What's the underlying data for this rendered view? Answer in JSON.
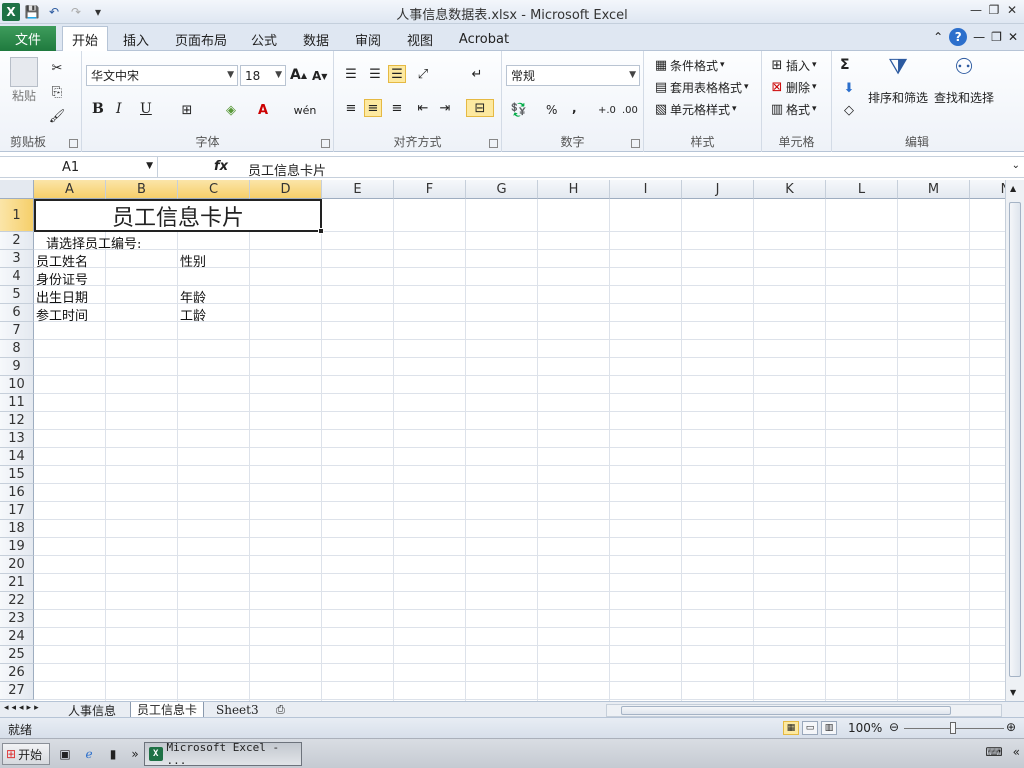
{
  "window": {
    "title": "人事信息数据表.xlsx  -  Microsoft Excel"
  },
  "ribbon_tabs": [
    "文件",
    "开始",
    "插入",
    "页面布局",
    "公式",
    "数据",
    "审阅",
    "视图",
    "Acrobat"
  ],
  "active_tab": "开始",
  "clipboard": {
    "paste_label": "粘贴",
    "group_label": "剪贴板"
  },
  "font": {
    "name": "华文中宋",
    "size": "18",
    "group_label": "字体",
    "bold": "B",
    "italic": "I",
    "underline": "U"
  },
  "alignment": {
    "group_label": "对齐方式"
  },
  "number": {
    "format": "常规",
    "percent": "%",
    "comma": ",",
    "inc_decimal": "+.0",
    "dec_decimal": ".00",
    "group_label": "数字"
  },
  "styles": {
    "conditional": "条件格式",
    "table_format": "套用表格格式",
    "cell_styles": "单元格样式",
    "group_label": "样式"
  },
  "cells": {
    "insert": "插入",
    "delete": "删除",
    "format": "格式",
    "group_label": "单元格"
  },
  "editing": {
    "sum": "Σ",
    "sort_filter": "排序和筛选",
    "find_select": "查找和选择",
    "group_label": "编辑"
  },
  "formula_bar": {
    "name_box": "A1",
    "fx": "fx",
    "content": "员工信息卡片"
  },
  "columns": [
    "A",
    "B",
    "C",
    "D",
    "E",
    "F",
    "G",
    "H",
    "I",
    "J",
    "K",
    "L",
    "M",
    "N"
  ],
  "rows": [
    "1",
    "2",
    "3",
    "4",
    "5",
    "6",
    "7",
    "8",
    "9",
    "10",
    "11",
    "12",
    "13",
    "14",
    "15",
    "16",
    "17",
    "18",
    "19",
    "20",
    "21",
    "22",
    "23",
    "24",
    "25",
    "26",
    "27"
  ],
  "sheet_cells": {
    "title": "员工信息卡片",
    "a2": "请选择员工编号:",
    "a3": "员工姓名",
    "c3": "性别",
    "a4": "身份证号",
    "a5": "出生日期",
    "c5": "年龄",
    "a6": "参工时间",
    "c6": "工龄"
  },
  "sheet_tabs": [
    "人事信息",
    "员工信息卡",
    "Sheet3"
  ],
  "active_sheet": "员工信息卡",
  "status": {
    "ready": "就绪",
    "zoom": "100%"
  },
  "taskbar": {
    "start": "开始",
    "task": "Microsoft Excel - ..."
  }
}
